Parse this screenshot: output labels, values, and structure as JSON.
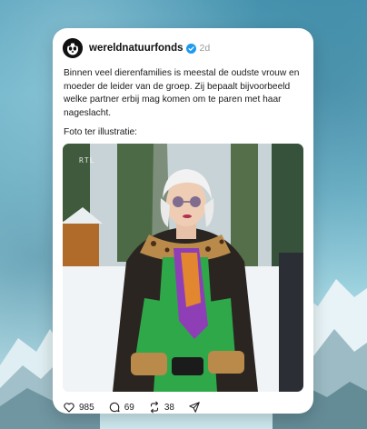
{
  "post": {
    "username": "wereldnatuurfonds",
    "time": "2d",
    "text": "Binnen veel dierenfamilies is meestal de oudste vrouw en moeder de leider van de groep. Zij bepaalt bijvoorbeeld welke partner erbij mag komen om te paren met haar nageslacht.",
    "caption": "Foto ter illustratie:",
    "image_watermark": "RTL",
    "likes": "985",
    "comments": "69",
    "reposts": "38"
  },
  "icons": {
    "avatar": "panda-logo-icon",
    "verified": "verified-badge-icon",
    "like": "heart-icon",
    "comment": "comment-icon",
    "repost": "repost-icon",
    "share": "send-icon"
  },
  "colors": {
    "verified": "#1d9bf0",
    "background": "#7ec3d6",
    "card": "#ffffff"
  }
}
